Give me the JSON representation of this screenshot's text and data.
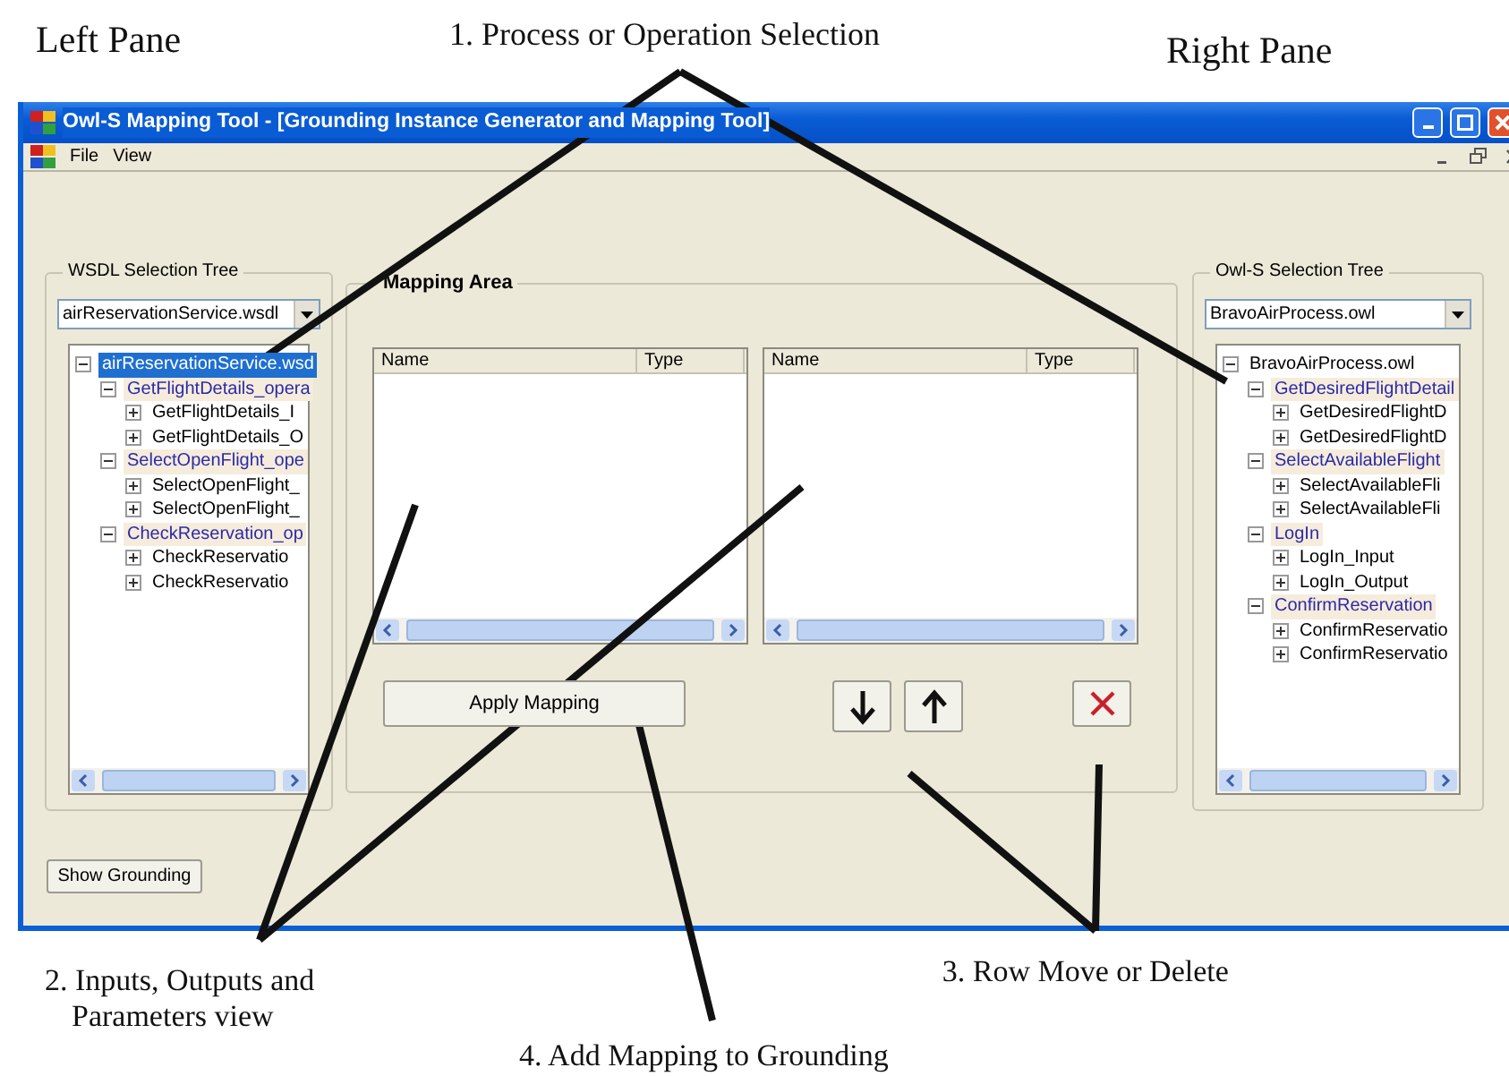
{
  "top_annotations": [
    "Left Pane",
    "1. Process or Operation Selection",
    "Right Pane"
  ],
  "window": {
    "title": "Owl-S Mapping Tool - [Grounding Instance Generator and Mapping Tool]",
    "menu": [
      "File",
      "View"
    ]
  },
  "wsdl_pane": {
    "title": "WSDL Selection Tree",
    "selector": "airReservationService.wsdl",
    "tree": [
      {
        "label": "airReservationService.wsd",
        "highlighted": false,
        "expanded": true,
        "selected": true,
        "children": [
          {
            "label": "GetFlightDetails_opera",
            "highlighted": true,
            "expanded": true,
            "selected": false,
            "children": [
              {
                "label": "GetFlightDetails_I",
                "highlighted": false,
                "expanded": false,
                "selected": false
              },
              {
                "label": "GetFlightDetails_O",
                "highlighted": false,
                "expanded": false,
                "selected": false
              }
            ]
          },
          {
            "label": "SelectOpenFlight_ope",
            "highlighted": true,
            "expanded": true,
            "selected": false,
            "children": [
              {
                "label": "SelectOpenFlight_",
                "highlighted": false,
                "expanded": false,
                "selected": false
              },
              {
                "label": "SelectOpenFlight_",
                "highlighted": false,
                "expanded": false,
                "selected": false
              }
            ]
          },
          {
            "label": "CheckReservation_op",
            "highlighted": true,
            "expanded": true,
            "selected": false,
            "children": [
              {
                "label": "CheckReservatio",
                "highlighted": false,
                "expanded": false,
                "selected": false
              },
              {
                "label": "CheckReservatio",
                "highlighted": false,
                "expanded": false,
                "selected": false
              }
            ]
          }
        ]
      }
    ]
  },
  "mapping_area": {
    "title": "Mapping Area",
    "lists": [
      {
        "columns": [
          "Name",
          "Type"
        ]
      },
      {
        "columns": [
          "Name",
          "Type"
        ]
      }
    ],
    "apply_button": "Apply Mapping"
  },
  "owl_pane": {
    "title": "Owl-S Selection Tree",
    "selector": "BravoAirProcess.owl",
    "tree": [
      {
        "label": "BravoAirProcess.owl",
        "highlighted": false,
        "expanded": true,
        "selected": false,
        "children": [
          {
            "label": "GetDesiredFlightDetail",
            "highlighted": true,
            "expanded": true,
            "selected": false,
            "children": [
              {
                "label": "GetDesiredFlightD",
                "highlighted": false,
                "expanded": false,
                "selected": false
              },
              {
                "label": "GetDesiredFlightD",
                "highlighted": false,
                "expanded": false,
                "selected": false
              }
            ]
          },
          {
            "label": "SelectAvailableFlight",
            "highlighted": true,
            "expanded": true,
            "selected": false,
            "children": [
              {
                "label": "SelectAvailableFli",
                "highlighted": false,
                "expanded": false,
                "selected": false
              },
              {
                "label": "SelectAvailableFli",
                "highlighted": false,
                "expanded": false,
                "selected": false
              }
            ]
          },
          {
            "label": "LogIn",
            "highlighted": true,
            "expanded": true,
            "selected": false,
            "children": [
              {
                "label": "LogIn_Input",
                "highlighted": false,
                "expanded": false,
                "selected": false
              },
              {
                "label": "LogIn_Output",
                "highlighted": false,
                "expanded": false,
                "selected": false
              }
            ]
          },
          {
            "label": "ConfirmReservation",
            "highlighted": true,
            "expanded": true,
            "selected": false,
            "children": [
              {
                "label": "ConfirmReservatio",
                "highlighted": false,
                "expanded": false,
                "selected": false
              },
              {
                "label": "ConfirmReservatio",
                "highlighted": false,
                "expanded": false,
                "selected": false
              }
            ]
          }
        ]
      }
    ]
  },
  "show_grounding_button": "Show Grounding",
  "bottom_annotations": [
    "2. Inputs, Outputs and Parameters view",
    "4. Add Mapping to Grounding",
    "3. Row Move or Delete"
  ]
}
